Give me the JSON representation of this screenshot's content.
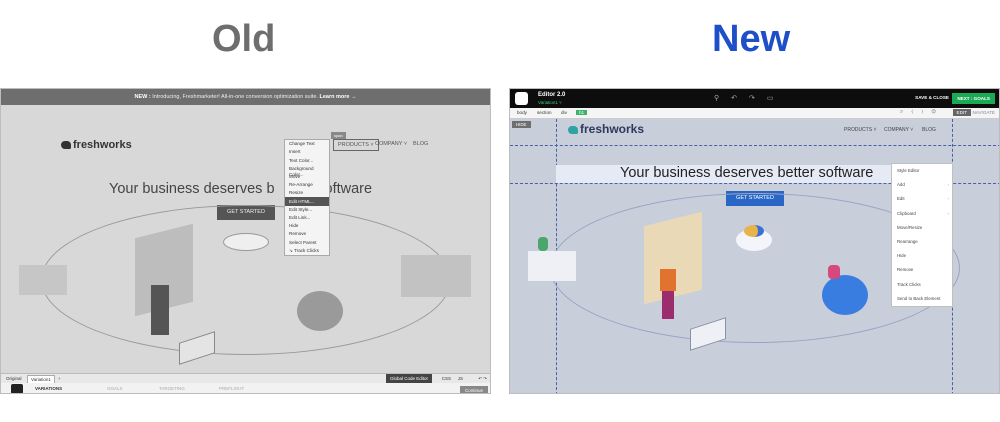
{
  "headings": {
    "old": "Old",
    "new": "New"
  },
  "old": {
    "announcement_prefix": "NEW :",
    "announcement_text": "Introducing, Freshmarketer! All-in-one conversion optimization suite.",
    "announcement_link": "Learn more →",
    "logo": "freshworks",
    "nav": {
      "products": "PRODUCTS ˅",
      "company": "COMPANY ˅",
      "blog": "BLOG"
    },
    "tag": "span",
    "headline": "Your business deserves b",
    "headline_tail": "oftware",
    "cta": "GET STARTED",
    "context_menu": [
      "Change Text",
      "Insert",
      "Text Color...",
      "Background Color...",
      "Move",
      "Re-Arrange",
      "Resize",
      "Edit HTML...",
      "Edit Style...",
      "Edit Link...",
      "Hide",
      "Remove",
      "Select Parent",
      "↘ Track Clicks"
    ],
    "tabs": {
      "original": "Original",
      "variation": "Variation1"
    },
    "global_code_editor": "Global Code Editor",
    "code_tabs": {
      "css": "CSS",
      "js": "JS"
    },
    "steps": {
      "variations": "VARIATIONS",
      "goals": "GOALS",
      "targeting": "TARGETING",
      "preflight": "PREFLIGHT"
    },
    "continue": "Continue"
  },
  "new": {
    "editor_title": "Editor 2.0",
    "variation": "Variation1 ˅",
    "save_close": "SAVE & CLOSE",
    "next_goals": "NEXT : GOALS",
    "breadcrumb": [
      "body",
      "section",
      "div",
      "h1"
    ],
    "mode_edit": "EDIT",
    "mode_navigate": "NAVIGATE",
    "hide": "HIDE",
    "logo": "freshworks",
    "nav": {
      "products": "PRODUCTS ˅",
      "company": "COMPANY ˅",
      "blog": "BLOG"
    },
    "headline": "Your business deserves better software",
    "cta": "GET STARTED",
    "context_menu": [
      "Style Editor",
      "Add",
      "Edit",
      "Clipboard",
      "Move/Resize",
      "Rearrange",
      "Hide",
      "Remove",
      "Track Clicks",
      "Send to Back Element"
    ]
  },
  "colors": {
    "new_heading": "#1f4fc8",
    "old_heading": "#6e6e6e",
    "cta_blue": "#2a66c5",
    "next_green": "#1aaa55"
  }
}
